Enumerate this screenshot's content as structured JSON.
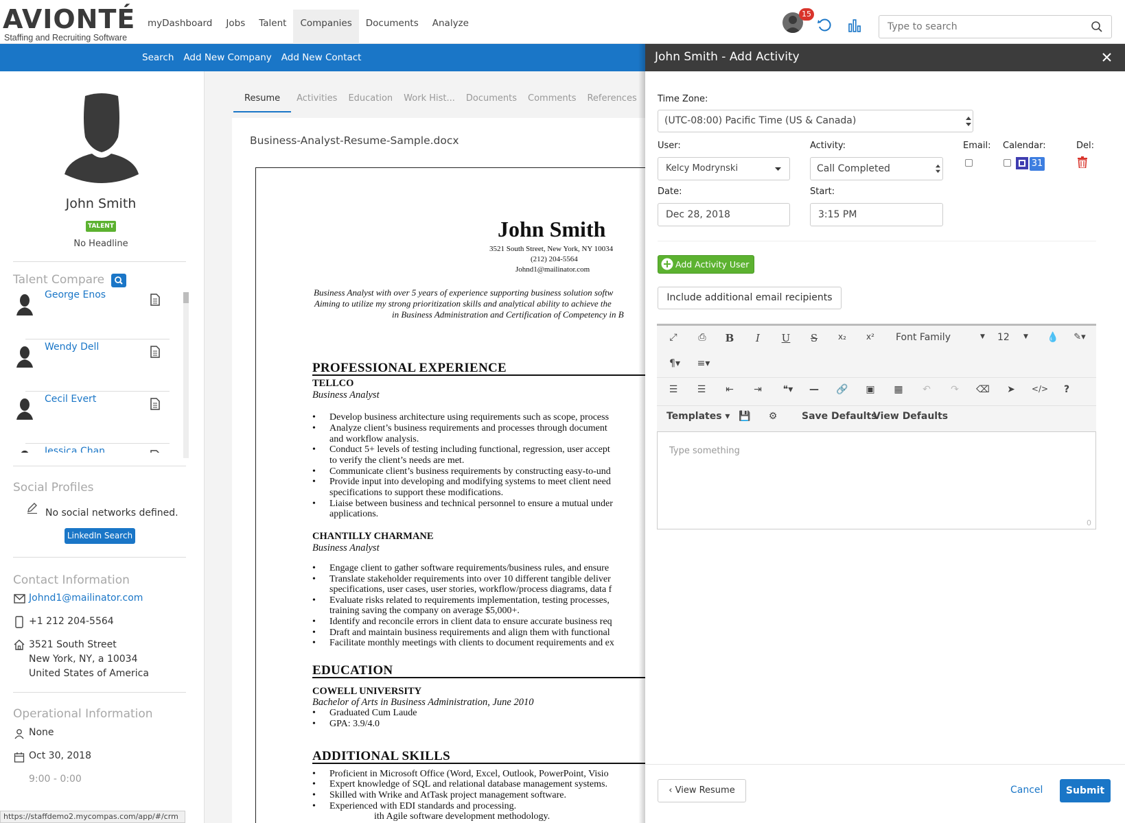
{
  "logo": {
    "name": "AVIONTÉ",
    "tagline": "Staffing and Recruiting Software"
  },
  "nav": {
    "items": [
      "myDashboard",
      "Jobs",
      "Talent",
      "Companies",
      "Documents",
      "Analyze"
    ],
    "active": "Companies"
  },
  "subnav": {
    "items": [
      "Search",
      "Add New Company",
      "Add New Contact"
    ]
  },
  "header": {
    "notification_count": "15",
    "search_placeholder": "Type to search"
  },
  "profile": {
    "name": "John Smith",
    "badge": "TALENT",
    "headline": "No Headline"
  },
  "talent_compare": {
    "title": "Talent Compare",
    "people": [
      "George Enos",
      "Wendy Dell",
      "Cecil Evert",
      "Jessica Chan"
    ]
  },
  "social": {
    "title": "Social Profiles",
    "empty_text": "No social networks defined.",
    "linkedin_button": "LinkedIn Search"
  },
  "contact": {
    "title": "Contact Information",
    "email": "Johnd1@mailinator.com",
    "phone": "+1 212 204-5564",
    "address_line1": "3521 South Street",
    "address_line2": "New York, NY, a 10034",
    "address_line3": "United States of America"
  },
  "operational": {
    "title": "Operational Information",
    "owner": "None",
    "date": "Oct 30, 2018",
    "partial": "9:00 - 0:00"
  },
  "status_url": "https://staffdemo2.mycompas.com/app/#/crm",
  "tabs": [
    "Resume",
    "Activities",
    "Education",
    "Work Hist...",
    "Documents",
    "Comments",
    "References"
  ],
  "document": {
    "filename": "Business-Analyst-Resume-Sample.docx",
    "name": "John Smith",
    "address": "3521 South Street, New York, NY 10034",
    "phone": "(212) 204-5564",
    "email": "Johnd1@mailinator.com",
    "summary": [
      "Business Analyst with over 5 years of experience supporting business solution softw",
      "Aiming to utilize my strong prioritization skills and analytical ability to achieve the",
      "in Business Administration and Certification of Competency in B"
    ],
    "section_experience": "PROFESSIONAL EXPERIENCE",
    "job1_company": "TELLCO",
    "job1_title": "Business Analyst",
    "job1_bullets": [
      "Develop business architecture using requirements such as scope, process",
      "Analyze client’s business requirements and processes through document",
      "and workflow analysis.",
      "Conduct 5+ levels of testing including functional, regression, user accept",
      "to verify the client’s needs are met.",
      "Communicate client’s business requirements by constructing easy-to-und",
      "Provide input into developing and modifying systems to meet client need",
      "specifications to support these modifications.",
      "Liaise between business and technical personnel to ensure a mutual under",
      "applications."
    ],
    "job2_company": "CHANTILLY CHARMANE",
    "job2_title": "Business Analyst",
    "job2_bullets": [
      "Engage client to gather software requirements/business rules, and ensure",
      "Translate stakeholder requirements into over 10 different tangible deliver",
      "specifications, user cases, user stories, workflow/process diagrams, data f",
      "Evaluate risks related to requirements implementation, testing processes,",
      "training saving the company on average $5,000+.",
      "Identify and reconcile errors in client data to ensure accurate business req",
      "Draft and maintain business requirements and align them with functional",
      "Facilitate monthly meetings with clients to document requirements and ex"
    ],
    "section_education": "EDUCATION",
    "school": "COWELL UNIVERSITY",
    "degree": "Bachelor of Arts in Business Administration, June 2010",
    "edu_bullets": [
      "Graduated Cum Laude",
      "GPA: 3.9/4.0"
    ],
    "section_skills": "ADDITIONAL SKILLS",
    "skills_bullets": [
      "Proficient in Microsoft Office (Word, Excel, Outlook, PowerPoint, Visio",
      "Expert knowledge of SQL and relational database management systems.",
      "Skilled with Wrike and AtTask project management software.",
      "Experienced with EDI standards and processing.",
      "ith Agile software development methodology."
    ]
  },
  "modal": {
    "title": "John Smith - Add Activity",
    "timezone_label": "Time Zone:",
    "timezone_value": "(UTC-08:00) Pacific Time (US & Canada)",
    "user_label": "User:",
    "user_value": "Kelcy Modrynski",
    "activity_label": "Activity:",
    "activity_value": "Call Completed",
    "email_label": "Email:",
    "calendar_label": "Calendar:",
    "calendar_day": "31",
    "del_label": "Del:",
    "date_label": "Date:",
    "date_value": "Dec 28, 2018",
    "start_label": "Start:",
    "start_value": "3:15 PM",
    "add_user_button": "Add Activity User",
    "include_recipients_button": "Include additional email recipients",
    "editor": {
      "font_family": "Font Family",
      "font_size": "12",
      "templates": "Templates",
      "save_defaults": "Save Defaults",
      "view_defaults": "View Defaults",
      "placeholder": "Type something",
      "char_count": "0"
    },
    "view_resume_button": "View Resume",
    "cancel_button": "Cancel",
    "submit_button": "Submit"
  },
  "colors": {
    "brand_blue": "#1a76c7",
    "talent_badge": "#5cb230",
    "add_user_green": "#5cb230",
    "delete_red": "#d9342b",
    "modal_header": "#3c3c3c"
  }
}
